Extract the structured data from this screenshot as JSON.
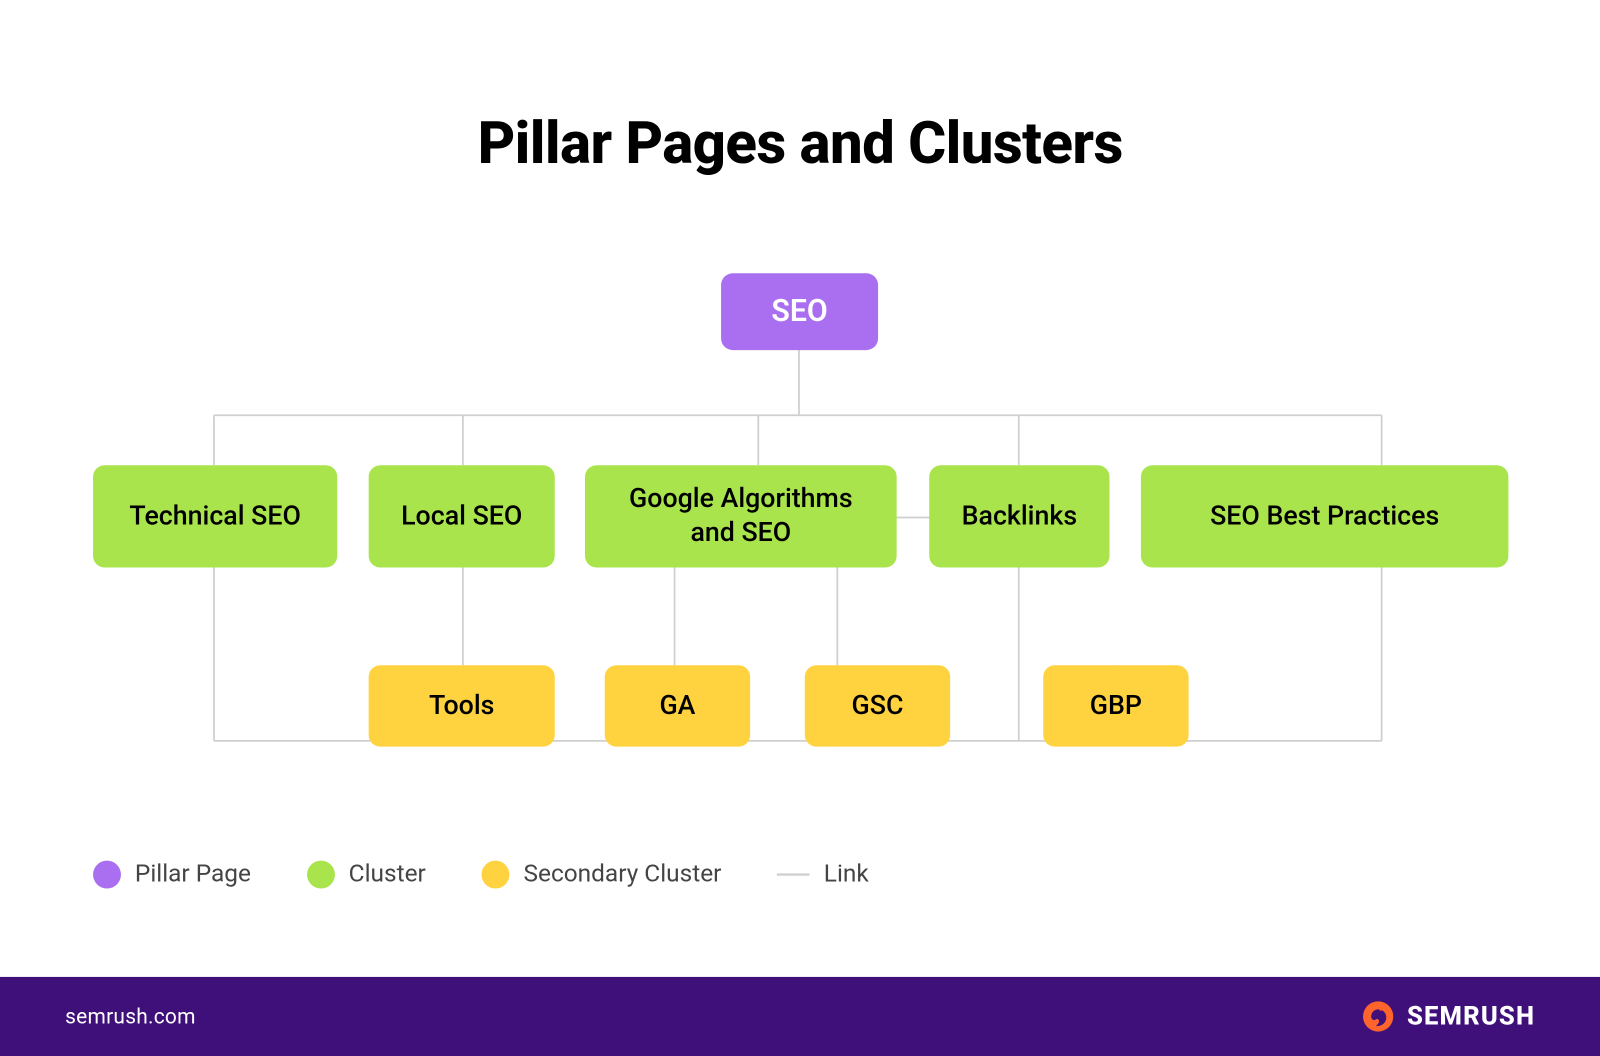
{
  "title": "Pillar Pages and Clusters",
  "colors": {
    "pillar": "#aa6ff0",
    "cluster": "#aae44d",
    "secondary": "#ffd23f",
    "link": "#cfcfcf",
    "footer_bg": "#3f107a",
    "accent": "#ff642d"
  },
  "nodes": {
    "root": "SEO",
    "clusters": [
      "Technical SEO",
      "Local SEO",
      "Google Algorithms and SEO",
      "Backlinks",
      "SEO Best Practices"
    ],
    "secondary": [
      "Tools",
      "GA",
      "GSC",
      "GBP"
    ]
  },
  "legend": {
    "pillar": "Pillar Page",
    "cluster": "Cluster",
    "secondary": "Secondary Cluster",
    "link": "Link"
  },
  "footer": {
    "url": "semrush.com",
    "brand": "SEMRUSH"
  }
}
